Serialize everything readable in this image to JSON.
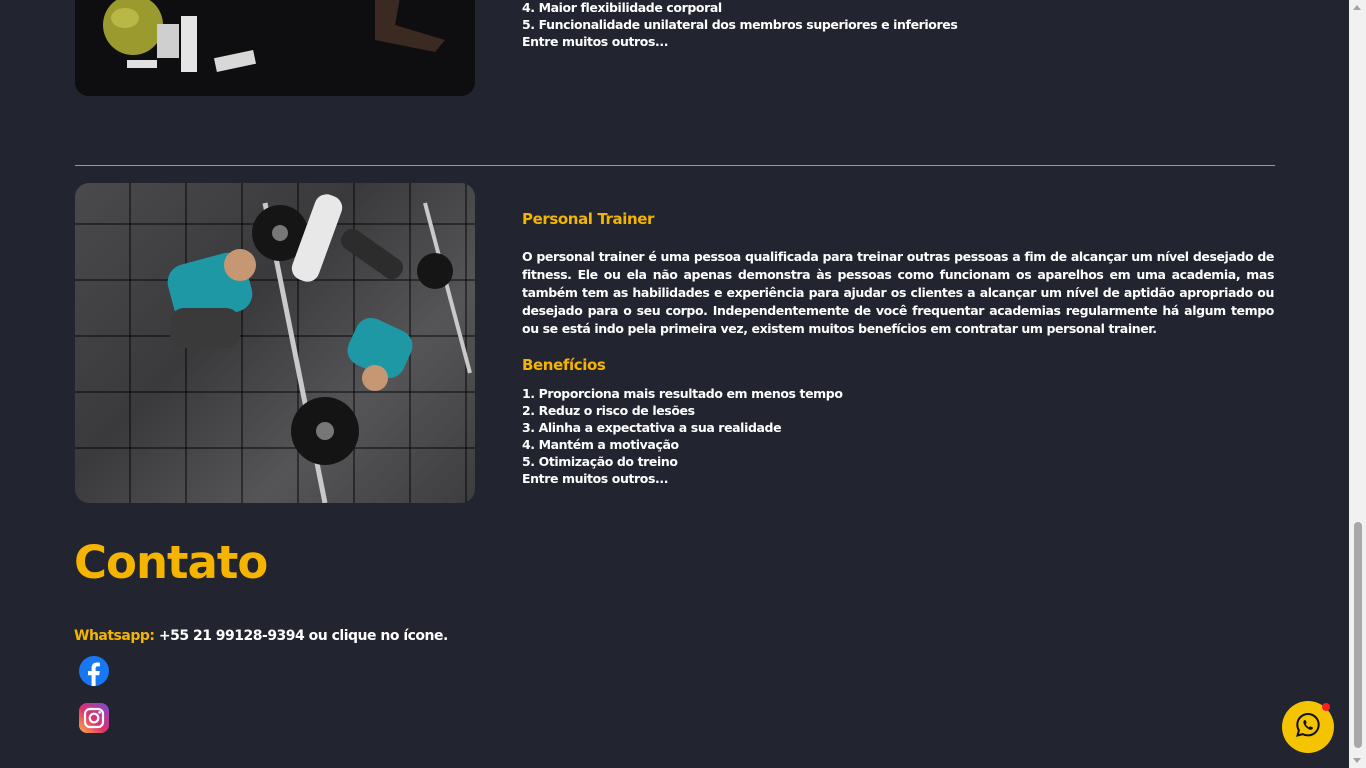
{
  "top_section": {
    "list_items": [
      "4. Maior flexibilidade corporal",
      "5. Funcionalidade unilateral dos membros superiores e inferiores",
      "Entre muitos outros..."
    ]
  },
  "personal_trainer": {
    "title": "Personal Trainer",
    "description": "O personal trainer é uma pessoa qualificada para treinar outras pessoas a fim de alcançar um nível desejado de fitness. Ele ou ela não apenas demonstra às pessoas como funcionam os aparelhos em uma academia, mas também tem as habilidades e experiência para ajudar os clientes a alcançar um nível de aptidão apropriado ou desejado para o seu corpo. Independentemente de você frequentar academias regularmente há algum tempo ou se está indo pela primeira vez, existem muitos benefícios em contratar um personal trainer.",
    "benefits_title": "Benefícios",
    "benefits": [
      "1. Proporciona mais resultado em menos tempo",
      "2. Reduz o risco de lesões",
      "3. Alinha a expectativa a sua realidade",
      "4. Mantém a motivação",
      "5. Otimização do treino",
      "Entre muitos outros..."
    ]
  },
  "contato": {
    "title": "Contato",
    "whatsapp_label": "Whatsapp:",
    "whatsapp_text": "+55 21 99128-9394 ou clique no ícone."
  },
  "icons": {
    "facebook": "facebook-icon",
    "instagram": "instagram-icon",
    "whatsapp_fab": "whatsapp-icon"
  },
  "colors": {
    "background": "#22242f",
    "accent": "#f4b400",
    "fab": "#f4c400",
    "notification": "#ff1e1e"
  }
}
